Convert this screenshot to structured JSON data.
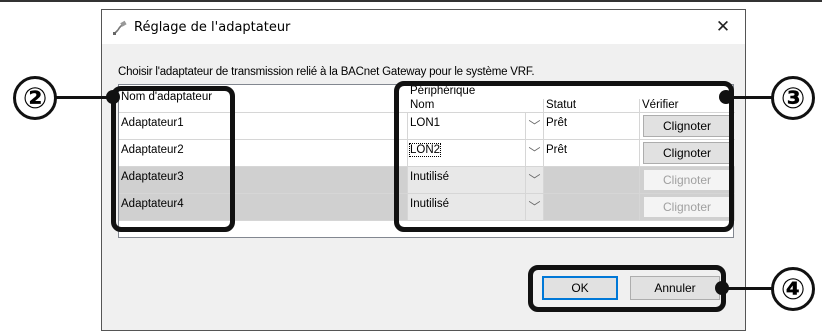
{
  "dialog": {
    "title": "Réglage de l'adaptateur",
    "close_glyph": "✕",
    "instruction": "Choisir l'adaptateur de transmission relié à la BACnet Gateway pour le système VRF."
  },
  "table": {
    "header_adapter": "Nom d'adaptateur",
    "header_group": "Périphérique",
    "header_name": "Nom",
    "header_status": "Statut",
    "header_verify": "Vérifier",
    "rows": [
      {
        "adapter": "Adaptateur1",
        "name": "LON1",
        "status": "Prêt",
        "verify": "Clignoter",
        "enabled": true
      },
      {
        "adapter": "Adaptateur2",
        "name": "LON2",
        "status": "Prêt",
        "verify": "Clignoter",
        "enabled": true
      },
      {
        "adapter": "Adaptateur3",
        "name": "Inutilisé",
        "status": "",
        "verify": "Clignoter",
        "enabled": false
      },
      {
        "adapter": "Adaptateur4",
        "name": "Inutilisé",
        "status": "",
        "verify": "Clignoter",
        "enabled": false
      }
    ]
  },
  "buttons": {
    "ok": "OK",
    "cancel": "Annuler"
  },
  "callouts": [
    "②",
    "③",
    "④"
  ],
  "icons": {
    "app": "adapter-plug-icon",
    "dropdown": "chevron-down-icon",
    "close": "close-icon"
  }
}
